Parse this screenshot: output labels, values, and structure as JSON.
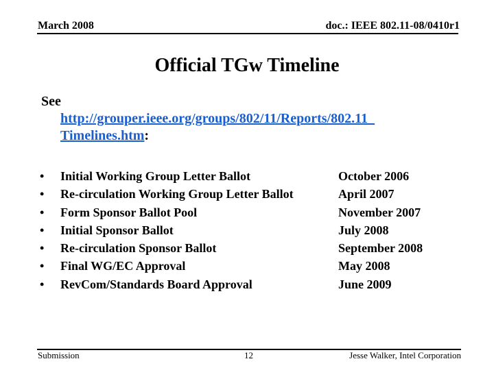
{
  "header": {
    "date": "March 2008",
    "doc_id": "doc.: IEEE 802.11-08/0410r1"
  },
  "slide": {
    "title": "Official TGw Timeline",
    "see_prefix": "See",
    "link_line1": "http://grouper.ieee.org/groups/802/11/Reports/802.11_",
    "link_line2": "Timelines.htm",
    "link_suffix": ":",
    "link_color": "#1a5fd0",
    "milestones": [
      {
        "label": "Initial Working Group Letter Ballot",
        "date": "October 2006"
      },
      {
        "label": "Re-circulation Working Group Letter Ballot",
        "date": "April 2007"
      },
      {
        "label": "Form Sponsor Ballot Pool",
        "date": "November 2007"
      },
      {
        "label": "Initial Sponsor Ballot",
        "date": "July 2008"
      },
      {
        "label": "Re-circulation Sponsor Ballot",
        "date": "September 2008"
      },
      {
        "label": "Final WG/EC Approval",
        "date": "May 2008"
      },
      {
        "label": "RevCom/Standards Board Approval",
        "date": "June 2009"
      }
    ],
    "bullet_glyph": "•"
  },
  "footer": {
    "left": "Submission",
    "page_number": "12",
    "author": "Jesse Walker, Intel Corporation"
  }
}
